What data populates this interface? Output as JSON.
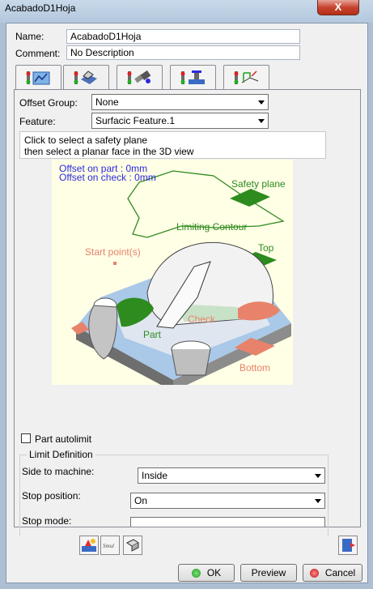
{
  "window": {
    "title": "AcabadoD1Hoja",
    "close_glyph": "X"
  },
  "fields": {
    "name_label": "Name:",
    "name_value": "AcabadoD1Hoja",
    "comment_label": "Comment:",
    "comment_value": "No Description"
  },
  "tabs": [
    {
      "icon": "strategy-tab-icon"
    },
    {
      "icon": "geometry-tab-icon"
    },
    {
      "icon": "tool-tab-icon"
    },
    {
      "icon": "feeds-speeds-tab-icon"
    },
    {
      "icon": "macros-tab-icon"
    }
  ],
  "geometry": {
    "offset_group_label": "Offset Group:",
    "offset_group_value": "None",
    "feature_label": "Feature:",
    "feature_value": "Surfacic Feature.1",
    "hint_line1": "Click to select a safety plane",
    "hint_line2": "then select a planar face in the 3D view"
  },
  "diagram": {
    "offset_part": "Offset on part : 0mm",
    "offset_check": "Offset on check : 0mm",
    "safety_plane": "Safety plane",
    "limiting_contour": "Limiting Contour",
    "start_point": "Start point(s)",
    "top": "Top",
    "check": "Check",
    "part": "Part",
    "bottom": "Bottom",
    "colors": {
      "green": "#2e8b1e",
      "salmon": "#e8826a",
      "blue": "#aac8e8",
      "label_blue": "#2a2ae0"
    }
  },
  "part_autolimit": {
    "label": "Part autolimit",
    "checked": false
  },
  "limit_definition": {
    "legend": "Limit Definition",
    "side_label": "Side to machine:",
    "side_value": "Inside",
    "stop_position_label": "Stop position:",
    "stop_position_value": "On",
    "stop_mode_label": "Stop mode:"
  },
  "toolbar": {
    "left_icons": [
      "replay-tool-path-icon",
      "simulation-icon",
      "display-options-icon"
    ],
    "right_icon": "report-icon"
  },
  "buttons": {
    "ok": "OK",
    "preview": "Preview",
    "cancel": "Cancel"
  }
}
